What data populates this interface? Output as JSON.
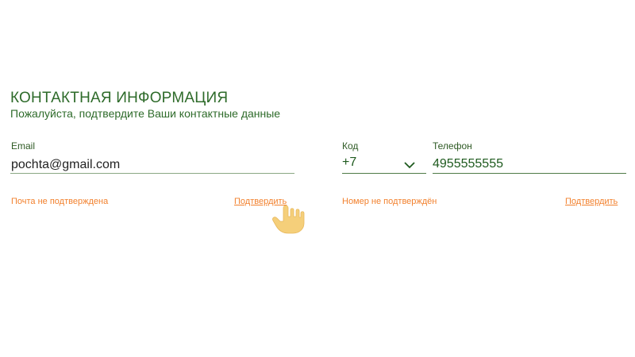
{
  "section": {
    "title": "КОНТАКТНАЯ ИНФОРМАЦИЯ",
    "subtitle": "Пожалуйста, подтвердите Ваши контактные данные"
  },
  "email": {
    "label": "Email",
    "value": "pochta@gmail.com",
    "status": "Почта не подтверждена",
    "confirm_link": "Подтвердить"
  },
  "phone": {
    "code_label": "Код",
    "code_value": "+7",
    "phone_label": "Телефон",
    "phone_value": "4955555555",
    "status": "Номер не подтверждён",
    "confirm_link": "Подтвердить"
  },
  "colors": {
    "primary_green": "#2e6b2a",
    "warning_orange": "#f2812e",
    "cursor_yellow": "#f5cf7a"
  },
  "icons": {
    "dropdown": "chevron-down-icon",
    "cursor": "pointer-hand-icon"
  }
}
